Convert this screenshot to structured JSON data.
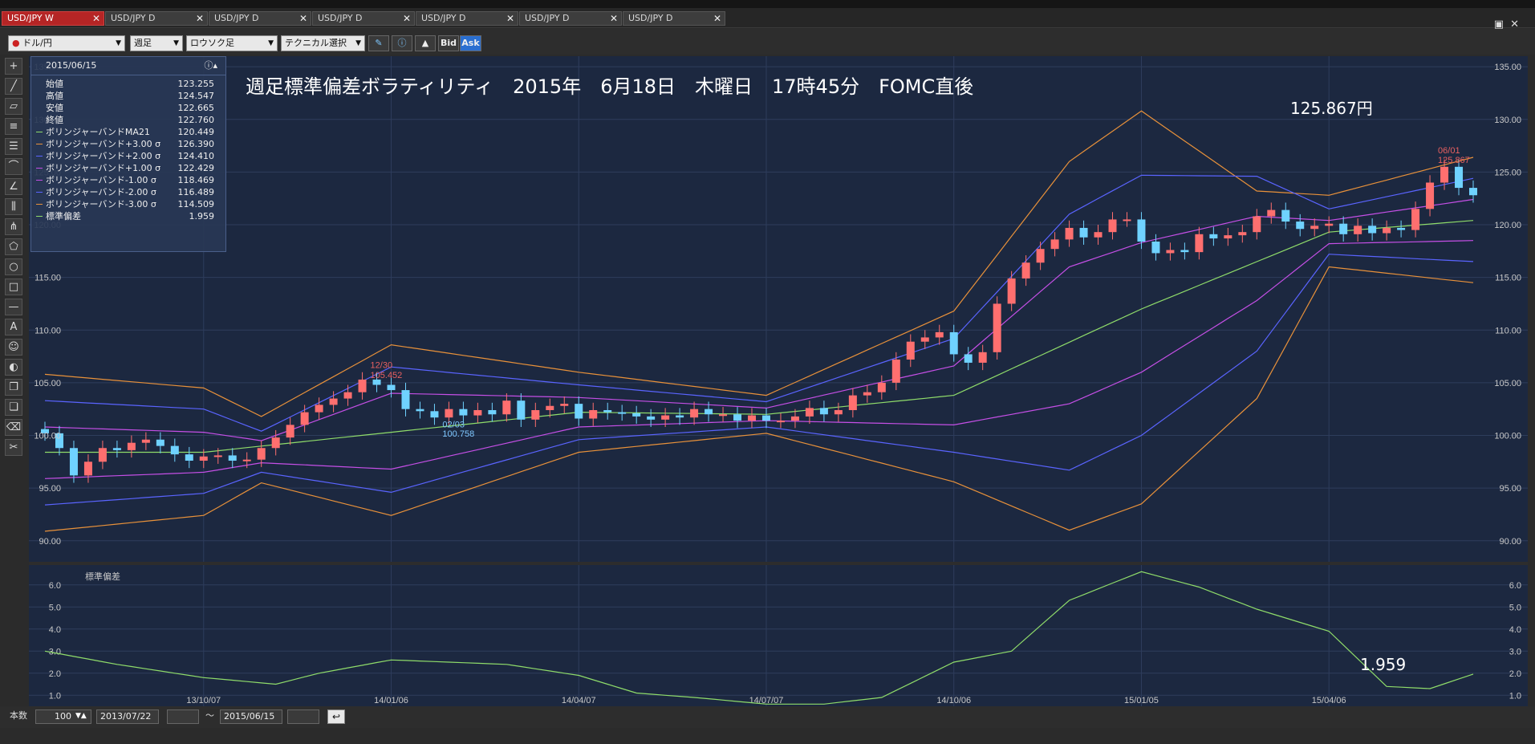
{
  "tabs": [
    {
      "label": "USD/JPY W",
      "active": true
    },
    {
      "label": "USD/JPY D",
      "active": false
    },
    {
      "label": "USD/JPY D",
      "active": false
    },
    {
      "label": "USD/JPY D",
      "active": false
    },
    {
      "label": "USD/JPY D",
      "active": false
    },
    {
      "label": "USD/JPY D",
      "active": false
    },
    {
      "label": "USD/JPY D",
      "active": false
    }
  ],
  "toolbar": {
    "pair": "ドル/円",
    "period": "週足",
    "chart_type": "ロウソク足",
    "technical": "テクニカル選択",
    "bid": "Bid",
    "ask": "Ask"
  },
  "legend": {
    "date": "2015/06/15",
    "rows": [
      {
        "label": "始値",
        "value": "123.255",
        "color": ""
      },
      {
        "label": "高値",
        "value": "124.547",
        "color": ""
      },
      {
        "label": "安値",
        "value": "122.665",
        "color": ""
      },
      {
        "label": "終値",
        "value": "122.760",
        "color": ""
      },
      {
        "label": "ボリンジャーバンドMA21",
        "value": "120.449",
        "color": "#8fdc6a"
      },
      {
        "label": "ボリンジャーバンド+3.00 σ",
        "value": "126.390",
        "color": "#e8913a"
      },
      {
        "label": "ボリンジャーバンド+2.00 σ",
        "value": "124.410",
        "color": "#5a64ff"
      },
      {
        "label": "ボリンジャーバンド+1.00 σ",
        "value": "122.429",
        "color": "#c54fe6"
      },
      {
        "label": "ボリンジャーバンド-1.00 σ",
        "value": "118.469",
        "color": "#c54fe6"
      },
      {
        "label": "ボリンジャーバンド-2.00 σ",
        "value": "116.489",
        "color": "#5a64ff"
      },
      {
        "label": "ボリンジャーバンド-3.00 σ",
        "value": "114.509",
        "color": "#e8913a"
      },
      {
        "label": "標準偏差",
        "value": "1.959",
        "color": "#8fdc6a"
      }
    ]
  },
  "headline": "週足標準偏差ボラティリティ　2015年　6月18日　木曜日　17時45分　FOMC直後",
  "price_note": "125.867円",
  "std_note": "1.959",
  "bottom": {
    "bars_label": "本数",
    "bars_value": "100",
    "from": "2013/07/22",
    "tilde": "～",
    "to": "2015/06/15"
  },
  "chart_data": [
    {
      "type": "candlestick",
      "title": "",
      "ylim": [
        88,
        136
      ],
      "yticks": [
        "135.00",
        "130.00",
        "125.00",
        "120.00",
        "115.00",
        "110.00",
        "105.00",
        "100.00",
        "95.00",
        "90.00"
      ],
      "x": [
        "2013/07/22",
        "2013/07/29",
        "2013/08/05",
        "2013/08/12",
        "2013/08/19",
        "2013/08/26",
        "2013/09/02",
        "2013/09/09",
        "2013/09/16",
        "2013/09/23",
        "2013/09/30",
        "2013/10/07",
        "2013/10/14",
        "2013/10/21",
        "2013/10/28",
        "2013/11/04",
        "2013/11/11",
        "2013/11/18",
        "2013/11/25",
        "2013/12/02",
        "2013/12/09",
        "2013/12/16",
        "2013/12/23",
        "2013/12/30",
        "2014/01/06",
        "2014/01/13",
        "2014/01/20",
        "2014/01/27",
        "2014/02/03",
        "2014/02/10",
        "2014/02/17",
        "2014/02/24",
        "2014/03/03",
        "2014/03/10",
        "2014/03/17",
        "2014/03/24",
        "2014/03/31",
        "2014/04/07",
        "2014/04/14",
        "2014/04/21",
        "2014/04/28",
        "2014/05/05",
        "2014/05/12",
        "2014/05/19",
        "2014/05/26",
        "2014/06/02",
        "2014/06/09",
        "2014/06/16",
        "2014/06/23",
        "2014/06/30",
        "2014/07/07",
        "2014/07/14",
        "2014/07/21",
        "2014/07/28",
        "2014/08/04",
        "2014/08/11",
        "2014/08/18",
        "2014/08/25",
        "2014/09/01",
        "2014/09/08",
        "2014/09/15",
        "2014/09/22",
        "2014/09/29",
        "2014/10/06",
        "2014/10/13",
        "2014/10/20",
        "2014/10/27",
        "2014/11/03",
        "2014/11/10",
        "2014/11/17",
        "2014/11/24",
        "2014/12/01",
        "2014/12/08",
        "2014/12/15",
        "2014/12/22",
        "2014/12/29",
        "2015/01/05",
        "2015/01/12",
        "2015/01/19",
        "2015/01/26",
        "2015/02/02",
        "2015/02/09",
        "2015/02/16",
        "2015/02/23",
        "2015/03/02",
        "2015/03/09",
        "2015/03/16",
        "2015/03/23",
        "2015/03/30",
        "2015/04/06",
        "2015/04/13",
        "2015/04/20",
        "2015/04/27",
        "2015/05/04",
        "2015/05/11",
        "2015/05/18",
        "2015/05/25",
        "2015/06/01",
        "2015/06/08",
        "2015/06/15"
      ],
      "xticks": [
        {
          "label": "13/10/07",
          "date": "2013/10/07"
        },
        {
          "label": "14/01/06",
          "date": "2014/01/06"
        },
        {
          "label": "14/04/07",
          "date": "2014/04/07"
        },
        {
          "label": "14/07/07",
          "date": "2014/07/07"
        },
        {
          "label": "14/10/06",
          "date": "2014/10/06"
        },
        {
          "label": "15/01/05",
          "date": "2015/01/05"
        },
        {
          "label": "15/04/06",
          "date": "2015/04/06"
        }
      ],
      "closes": [
        100.2,
        98.8,
        96.2,
        97.5,
        98.8,
        98.6,
        99.3,
        99.6,
        99.0,
        98.2,
        97.6,
        98.0,
        98.1,
        97.6,
        97.7,
        98.8,
        99.8,
        101.0,
        102.2,
        102.9,
        103.5,
        104.1,
        105.3,
        104.8,
        104.3,
        102.5,
        102.3,
        101.7,
        102.5,
        101.9,
        102.4,
        102.0,
        103.3,
        101.5,
        102.4,
        102.8,
        103.0,
        101.6,
        102.4,
        102.2,
        102.1,
        101.8,
        101.5,
        101.9,
        101.7,
        102.5,
        102.0,
        102.0,
        101.4,
        101.9,
        101.4,
        101.4,
        101.8,
        102.6,
        102.0,
        102.4,
        103.8,
        104.1,
        105.0,
        107.2,
        108.9,
        109.3,
        109.8,
        107.7,
        106.9,
        107.9,
        112.5,
        114.9,
        116.4,
        117.7,
        118.6,
        119.7,
        118.8,
        119.3,
        120.5,
        120.5,
        118.4,
        117.3,
        117.6,
        117.4,
        119.1,
        118.7,
        119.0,
        119.3,
        120.8,
        121.4,
        120.3,
        119.6,
        119.9,
        120.1,
        119.1,
        119.9,
        119.2,
        119.7,
        119.5,
        121.5,
        124.0,
        125.5,
        123.5,
        122.8
      ],
      "annotations": [
        {
          "text": "12/30",
          "x": "2013/12/30",
          "y": 106.4,
          "color": "#e86060"
        },
        {
          "text": "105.452",
          "x": "2013/12/30",
          "y": 105.452,
          "color": "#e86060"
        },
        {
          "text": "02/03",
          "x": "2014/02/03",
          "y": 100.758,
          "color": "#7fc8ff"
        },
        {
          "text": "100.758",
          "x": "2014/02/03",
          "y": 99.9,
          "color": "#7fc8ff"
        },
        {
          "text": "06/01",
          "x": "2015/06/01",
          "y": 126.8,
          "color": "#e86060"
        },
        {
          "text": "125.867",
          "x": "2015/06/01",
          "y": 125.867,
          "color": "#e86060"
        }
      ],
      "series": [
        {
          "name": "ボリンジャーバンドMA21",
          "color": "#8fdc6a",
          "points": [
            {
              "x": "2013/07/22",
              "y": 98.4
            },
            {
              "x": "2013/10/07",
              "y": 98.4
            },
            {
              "x": "2014/01/06",
              "y": 100.3
            },
            {
              "x": "2014/04/07",
              "y": 102.2
            },
            {
              "x": "2014/07/07",
              "y": 102.0
            },
            {
              "x": "2014/10/06",
              "y": 103.8
            },
            {
              "x": "2015/01/05",
              "y": 112.0
            },
            {
              "x": "2015/04/06",
              "y": 119.3
            },
            {
              "x": "2015/06/15",
              "y": 120.4
            }
          ]
        },
        {
          "name": "ボリンジャーバンド+3.00 σ",
          "color": "#e8913a",
          "points": [
            {
              "x": "2013/07/22",
              "y": 105.8
            },
            {
              "x": "2013/10/07",
              "y": 104.5
            },
            {
              "x": "2013/11/04",
              "y": 101.8
            },
            {
              "x": "2014/01/06",
              "y": 108.6
            },
            {
              "x": "2014/04/07",
              "y": 106.0
            },
            {
              "x": "2014/07/07",
              "y": 103.8
            },
            {
              "x": "2014/10/06",
              "y": 111.8
            },
            {
              "x": "2014/12/01",
              "y": 126.0
            },
            {
              "x": "2015/01/05",
              "y": 130.8
            },
            {
              "x": "2015/03/02",
              "y": 123.2
            },
            {
              "x": "2015/04/06",
              "y": 122.8
            },
            {
              "x": "2015/06/15",
              "y": 126.4
            }
          ]
        },
        {
          "name": "ボリンジャーバンド+2.00 σ",
          "color": "#5a64ff",
          "points": [
            {
              "x": "2013/07/22",
              "y": 103.3
            },
            {
              "x": "2013/10/07",
              "y": 102.5
            },
            {
              "x": "2013/11/04",
              "y": 100.4
            },
            {
              "x": "2014/01/06",
              "y": 106.5
            },
            {
              "x": "2014/04/07",
              "y": 104.8
            },
            {
              "x": "2014/07/07",
              "y": 103.2
            },
            {
              "x": "2014/10/06",
              "y": 109.2
            },
            {
              "x": "2014/12/01",
              "y": 121.0
            },
            {
              "x": "2015/01/05",
              "y": 124.7
            },
            {
              "x": "2015/03/02",
              "y": 124.6
            },
            {
              "x": "2015/04/06",
              "y": 121.5
            },
            {
              "x": "2015/06/15",
              "y": 124.4
            }
          ]
        },
        {
          "name": "ボリンジャーバンド+1.00 σ",
          "color": "#c54fe6",
          "points": [
            {
              "x": "2013/07/22",
              "y": 100.8
            },
            {
              "x": "2013/10/07",
              "y": 100.3
            },
            {
              "x": "2013/11/04",
              "y": 99.5
            },
            {
              "x": "2014/01/06",
              "y": 104.0
            },
            {
              "x": "2014/04/07",
              "y": 103.6
            },
            {
              "x": "2014/07/07",
              "y": 102.6
            },
            {
              "x": "2014/10/06",
              "y": 106.6
            },
            {
              "x": "2014/12/01",
              "y": 116.0
            },
            {
              "x": "2015/01/05",
              "y": 118.3
            },
            {
              "x": "2015/03/02",
              "y": 120.8
            },
            {
              "x": "2015/04/06",
              "y": 120.4
            },
            {
              "x": "2015/06/15",
              "y": 122.4
            }
          ]
        },
        {
          "name": "ボリンジャーバンド-1.00 σ",
          "color": "#c54fe6",
          "points": [
            {
              "x": "2013/07/22",
              "y": 95.9
            },
            {
              "x": "2013/10/07",
              "y": 96.5
            },
            {
              "x": "2013/11/04",
              "y": 97.4
            },
            {
              "x": "2014/01/06",
              "y": 96.8
            },
            {
              "x": "2014/04/07",
              "y": 100.8
            },
            {
              "x": "2014/07/07",
              "y": 101.4
            },
            {
              "x": "2014/10/06",
              "y": 101.0
            },
            {
              "x": "2014/12/01",
              "y": 103.0
            },
            {
              "x": "2015/01/05",
              "y": 106.0
            },
            {
              "x": "2015/03/02",
              "y": 112.8
            },
            {
              "x": "2015/04/06",
              "y": 118.2
            },
            {
              "x": "2015/06/15",
              "y": 118.5
            }
          ]
        },
        {
          "name": "ボリンジャーバンド-2.00 σ",
          "color": "#5a64ff",
          "points": [
            {
              "x": "2013/07/22",
              "y": 93.4
            },
            {
              "x": "2013/10/07",
              "y": 94.5
            },
            {
              "x": "2013/11/04",
              "y": 96.5
            },
            {
              "x": "2014/01/06",
              "y": 94.6
            },
            {
              "x": "2014/04/07",
              "y": 99.6
            },
            {
              "x": "2014/07/07",
              "y": 100.8
            },
            {
              "x": "2014/10/06",
              "y": 98.4
            },
            {
              "x": "2014/12/01",
              "y": 96.7
            },
            {
              "x": "2015/01/05",
              "y": 100.0
            },
            {
              "x": "2015/03/02",
              "y": 108.0
            },
            {
              "x": "2015/04/06",
              "y": 117.2
            },
            {
              "x": "2015/06/15",
              "y": 116.5
            }
          ]
        },
        {
          "name": "ボリンジャーバンド-3.00 σ",
          "color": "#e8913a",
          "points": [
            {
              "x": "2013/07/22",
              "y": 90.9
            },
            {
              "x": "2013/10/07",
              "y": 92.4
            },
            {
              "x": "2013/11/04",
              "y": 95.5
            },
            {
              "x": "2014/01/06",
              "y": 92.4
            },
            {
              "x": "2014/04/07",
              "y": 98.4
            },
            {
              "x": "2014/07/07",
              "y": 100.2
            },
            {
              "x": "2014/10/06",
              "y": 95.6
            },
            {
              "x": "2014/12/01",
              "y": 91.0
            },
            {
              "x": "2015/01/05",
              "y": 93.5
            },
            {
              "x": "2015/03/02",
              "y": 103.5
            },
            {
              "x": "2015/04/06",
              "y": 116.0
            },
            {
              "x": "2015/06/15",
              "y": 114.5
            }
          ]
        }
      ]
    },
    {
      "type": "line",
      "title": "標準偏差",
      "ylim": [
        0.5,
        6.9
      ],
      "yticks": [
        "6.0",
        "5.0",
        "4.0",
        "3.0",
        "2.0",
        "1.0"
      ],
      "series": [
        {
          "name": "標準偏差",
          "color": "#8fdc6a",
          "points": [
            {
              "x": "2013/07/22",
              "y": 3.0
            },
            {
              "x": "2013/08/26",
              "y": 2.4
            },
            {
              "x": "2013/10/07",
              "y": 1.8
            },
            {
              "x": "2013/11/11",
              "y": 1.5
            },
            {
              "x": "2013/12/02",
              "y": 2.0
            },
            {
              "x": "2014/01/06",
              "y": 2.6
            },
            {
              "x": "2014/02/03",
              "y": 2.5
            },
            {
              "x": "2014/03/03",
              "y": 2.4
            },
            {
              "x": "2014/04/07",
              "y": 1.9
            },
            {
              "x": "2014/05/05",
              "y": 1.1
            },
            {
              "x": "2014/06/02",
              "y": 0.9
            },
            {
              "x": "2014/07/07",
              "y": 0.6
            },
            {
              "x": "2014/08/04",
              "y": 0.6
            },
            {
              "x": "2014/09/01",
              "y": 0.9
            },
            {
              "x": "2014/10/06",
              "y": 2.5
            },
            {
              "x": "2014/11/03",
              "y": 3.0
            },
            {
              "x": "2014/12/01",
              "y": 5.3
            },
            {
              "x": "2015/01/05",
              "y": 6.6
            },
            {
              "x": "2015/02/02",
              "y": 5.9
            },
            {
              "x": "2015/03/02",
              "y": 4.9
            },
            {
              "x": "2015/04/06",
              "y": 3.9
            },
            {
              "x": "2015/05/04",
              "y": 1.4
            },
            {
              "x": "2015/05/25",
              "y": 1.3
            },
            {
              "x": "2015/06/15",
              "y": 1.96
            }
          ]
        }
      ]
    }
  ]
}
